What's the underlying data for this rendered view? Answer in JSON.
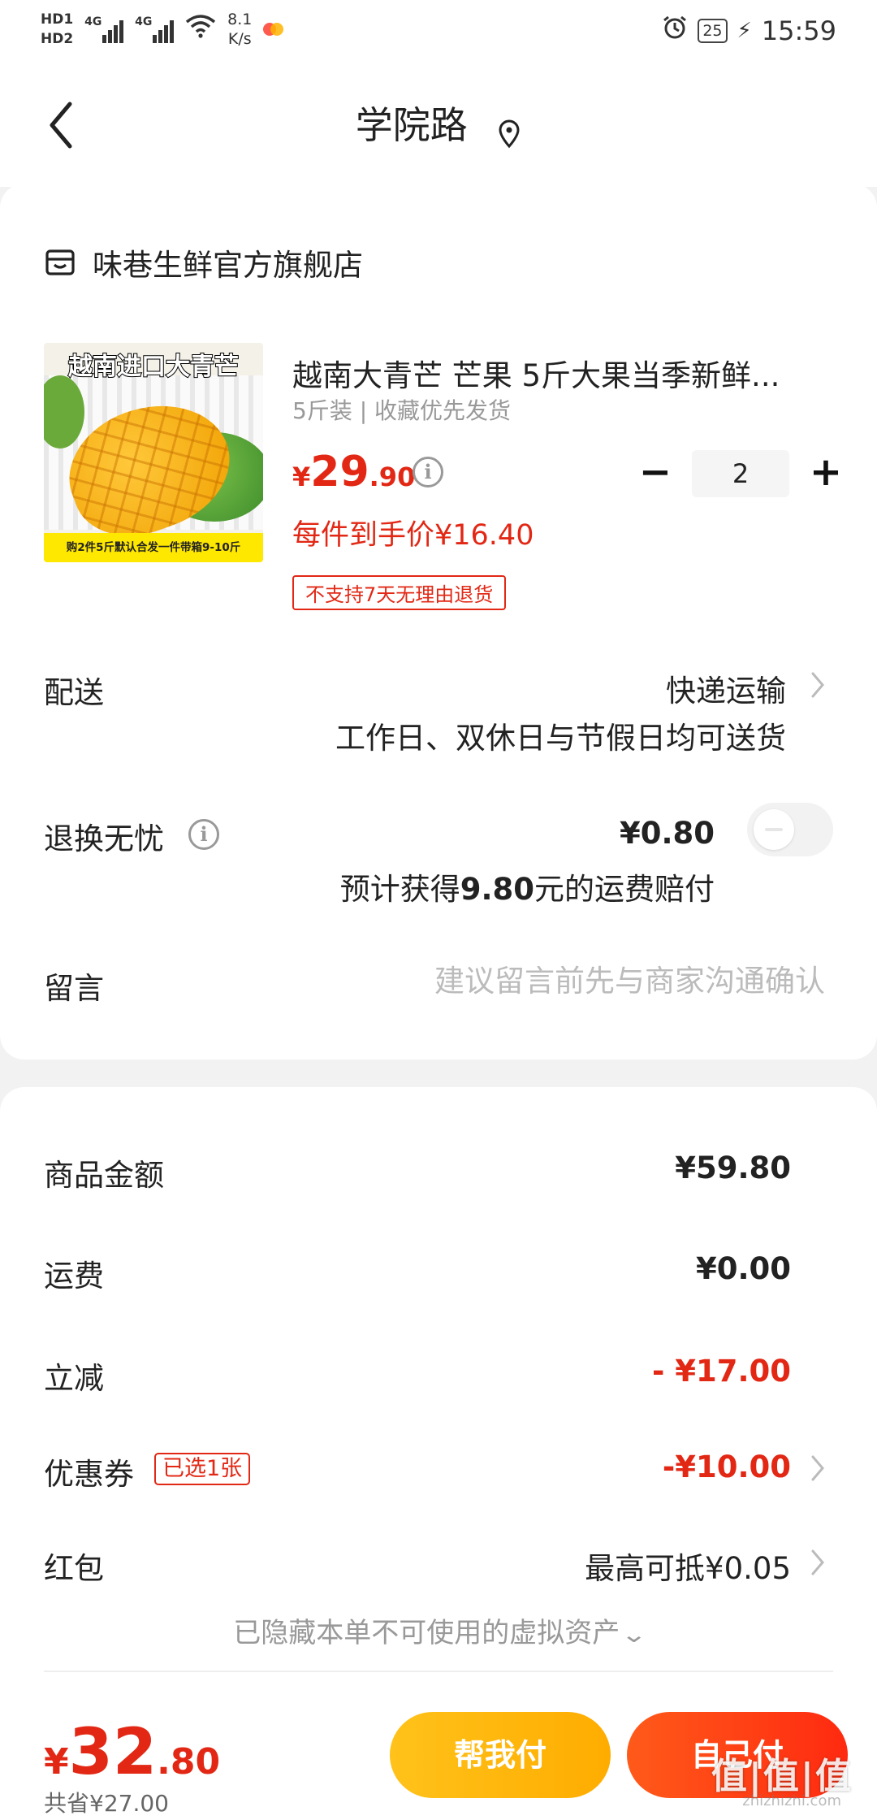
{
  "status_bar": {
    "hd1": "HD1",
    "hd2": "HD2",
    "sig1": "4G",
    "sig2": "4G",
    "net_speed_value": "8.1",
    "net_speed_unit": "K/s",
    "battery": "25",
    "time": "15:59"
  },
  "header": {
    "title": "学院路"
  },
  "store": {
    "name": "味巷生鲜官方旗舰店"
  },
  "product": {
    "image_title": "越南进口大青芒",
    "image_banner": "购2件5斤默认合发一件带箱9-10斤",
    "name": "越南大青芒 芒果 5斤大果当季新鲜...",
    "spec": "5斤装 | 收藏优先发货",
    "price_currency": "¥",
    "price_int": "29",
    "price_dec": ".90",
    "unit_price": "每件到手价¥16.40",
    "return_tag": "不支持7天无理由退货",
    "quantity": "2",
    "minus": "−",
    "plus": "+"
  },
  "delivery": {
    "label": "配送",
    "method": "快递运输",
    "note": "工作日、双休日与节假日均可送货"
  },
  "return_insurance": {
    "label": "退换无忧",
    "price": "¥0.80",
    "note_prefix": "预计获得",
    "note_amount": "9.80",
    "note_suffix": "元的运费赔付",
    "enabled": false
  },
  "message": {
    "label": "留言",
    "placeholder": "建议留言前先与商家沟通确认"
  },
  "summary": {
    "goods_label": "商品金额",
    "goods_value": "¥59.80",
    "shipping_label": "运费",
    "shipping_value": "¥0.00",
    "discount_label": "立减",
    "discount_value": "- ¥17.00",
    "coupon_label": "优惠券",
    "coupon_tag": "已选1张",
    "coupon_value": "-¥10.00",
    "redpacket_label": "红包",
    "redpacket_value": "最高可抵¥0.05",
    "hidden_assets": "已隐藏本单不可使用的虚拟资产"
  },
  "bottom": {
    "total_currency": "¥",
    "total_int": "32",
    "total_dec": ".80",
    "saved": "共省¥27.00",
    "help_pay": "帮我付",
    "self_pay": "自己付"
  },
  "watermark": {
    "text": "值|值|值",
    "url": "zhizhizhi.com"
  },
  "colors": {
    "accent_red": "#e22815",
    "help_button": "#ffb800",
    "self_button": "#ff3a12",
    "background": "#f2f2f2"
  },
  "icons": [
    "back-icon",
    "location-icon",
    "store-icon",
    "info-icon",
    "chevron-right-icon",
    "chevron-down-icon",
    "alarm-icon",
    "wifi-icon",
    "signal-icon",
    "battery-icon"
  ]
}
